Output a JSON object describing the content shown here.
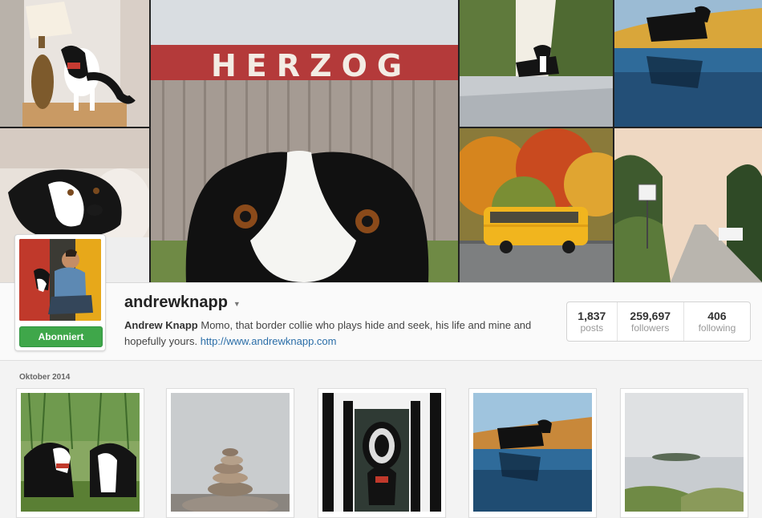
{
  "hero": {
    "sign_text": "HERZOG"
  },
  "profile": {
    "username": "andrewknapp",
    "full_name": "Andrew Knapp",
    "bio": "Momo, that border collie who plays hide and seek, his life and mine and hopefully yours.",
    "website": "http://www.andrewknapp.com",
    "follow_label": "Abonniert"
  },
  "stats": {
    "posts_count": "1,837",
    "posts_label": "posts",
    "followers_count": "259,697",
    "followers_label": "followers",
    "following_count": "406",
    "following_label": "following"
  },
  "feed": {
    "month_label": "Oktober 2014"
  }
}
